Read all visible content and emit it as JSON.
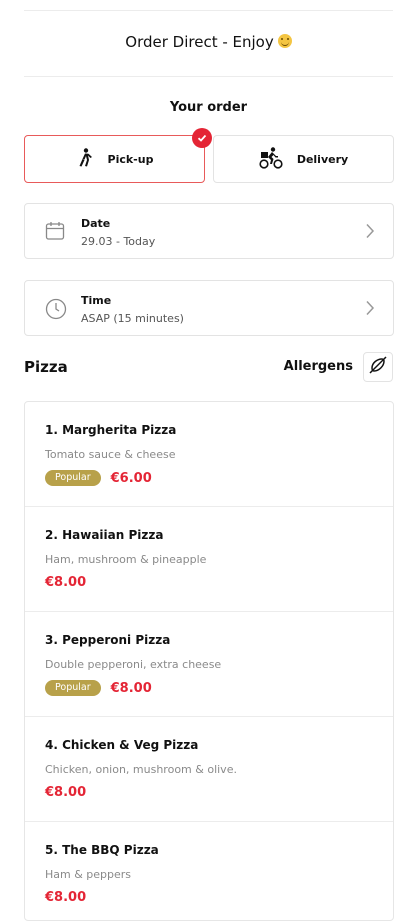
{
  "header": {
    "title": "Order Direct - Enjoy",
    "emoji_icon": "smiling-face-emoji"
  },
  "order": {
    "section_title": "Your order",
    "modes": [
      {
        "label": "Pick-up",
        "icon": "walking-person-icon",
        "selected": true
      },
      {
        "label": "Delivery",
        "icon": "delivery-bike-icon",
        "selected": false
      }
    ],
    "date": {
      "label": "Date",
      "value": "29.03 - Today"
    },
    "time": {
      "label": "Time",
      "value": "ASAP (15 minutes)"
    }
  },
  "menu": {
    "category": "Pizza",
    "allergens_label": "Allergens",
    "items": [
      {
        "name": "1. Margherita Pizza",
        "description": "Tomato sauce & cheese",
        "badge": "Popular",
        "price": "€6.00"
      },
      {
        "name": "2. Hawaiian Pizza",
        "description": "Ham, mushroom & pineapple",
        "badge": "",
        "price": "€8.00"
      },
      {
        "name": "3. Pepperoni Pizza",
        "description": "Double pepperoni, extra cheese",
        "badge": "Popular",
        "price": "€8.00"
      },
      {
        "name": "4. Chicken & Veg Pizza",
        "description": "Chicken, onion, mushroom & olive.",
        "badge": "",
        "price": "€8.00"
      },
      {
        "name": "5. The BBQ Pizza",
        "description": "Ham & peppers",
        "badge": "",
        "price": "€8.00"
      }
    ]
  },
  "colors": {
    "accent_red": "#e42535",
    "badge_gold": "#b8a14a",
    "border": "#e3e3e3"
  }
}
